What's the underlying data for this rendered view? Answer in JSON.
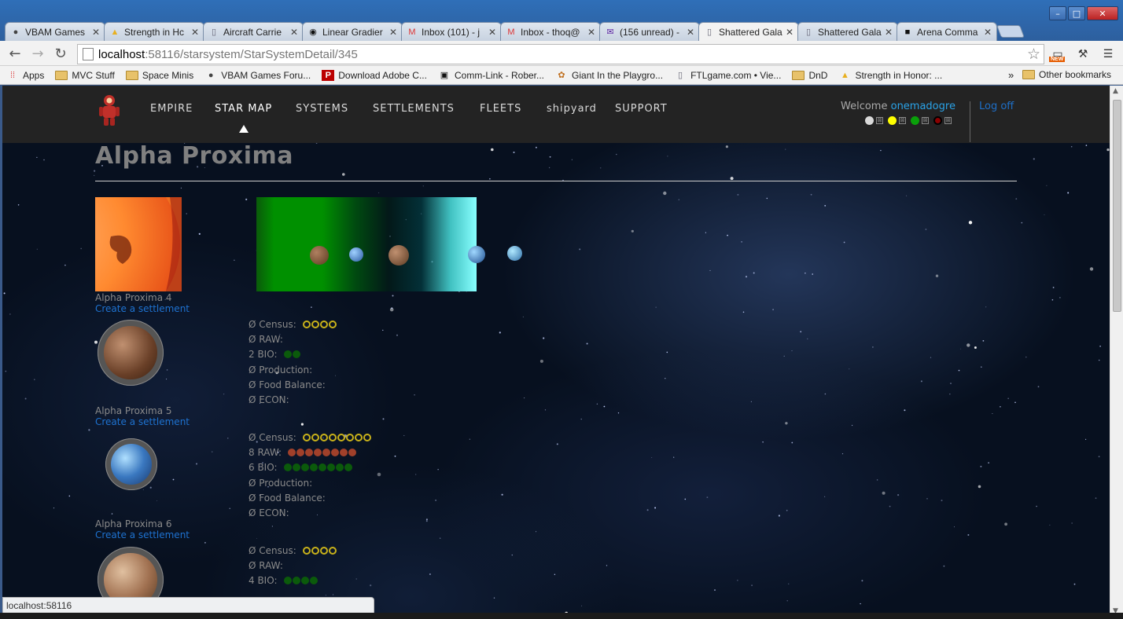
{
  "browser": {
    "tabs": [
      {
        "title": "VBAM Games",
        "icon": "globe-icon"
      },
      {
        "title": "Strength in Hc",
        "icon": "warning-icon"
      },
      {
        "title": "Aircraft Carrie",
        "icon": "page-icon"
      },
      {
        "title": "Linear Gradier",
        "icon": "github-icon"
      },
      {
        "title": "Inbox (101) - j",
        "icon": "gmail-icon"
      },
      {
        "title": "Inbox - thoq@",
        "icon": "gmail-icon"
      },
      {
        "title": "(156 unread) -",
        "icon": "mail-icon"
      },
      {
        "title": "Shattered Gala",
        "icon": "page-icon",
        "active": true
      },
      {
        "title": "Shattered Gala",
        "icon": "page-icon"
      },
      {
        "title": "Arena Comma",
        "icon": "arena-icon"
      }
    ],
    "url_host": "localhost",
    "url_path": ":58116/starsystem/StarSystemDetail/345",
    "new_badge": "NEW",
    "bookmarks": [
      {
        "label": "Apps",
        "icon": "apps-icon"
      },
      {
        "label": "MVC Stuff",
        "icon": "folder-icon"
      },
      {
        "label": "Space Minis",
        "icon": "folder-icon"
      },
      {
        "label": "VBAM Games Foru...",
        "icon": "globe-icon"
      },
      {
        "label": "Download Adobe C...",
        "icon": "pinterest-icon"
      },
      {
        "label": "Comm-Link - Rober...",
        "icon": "rsi-icon"
      },
      {
        "label": "Giant In the Playgro...",
        "icon": "giant-icon"
      },
      {
        "label": "FTLgame.com • Vie...",
        "icon": "page-icon"
      },
      {
        "label": "DnD",
        "icon": "folder-icon"
      },
      {
        "label": "Strength in Honor: ...",
        "icon": "warning-icon"
      }
    ],
    "bookmarks_overflow": "»",
    "other_bookmarks": "Other bookmarks",
    "status_url": "localhost:58116"
  },
  "site": {
    "nav": [
      {
        "label": "EMPIRE"
      },
      {
        "label": "STAR MAP",
        "current": true
      },
      {
        "label": "SYSTEMS"
      },
      {
        "label": "SETTLEMENTS"
      },
      {
        "label": "FLEETS"
      },
      {
        "label": "shipyard"
      },
      {
        "label": "SUPPORT"
      }
    ],
    "welcome_prefix": "Welcome ",
    "username": "onemadogre",
    "logoff": "Log off",
    "player_colors": [
      "#d9d9d9",
      "#ffff00",
      "#0aa00a",
      "#8a0000"
    ],
    "check_glyph": "⊠"
  },
  "system": {
    "title": "Alpha Proxima",
    "planets": [
      {
        "name": "Alpha Proxima 4",
        "link": "Create a settlement",
        "stats": [
          {
            "label": "Ø Census:",
            "pips": 4,
            "pip": "y"
          },
          {
            "label": "Ø RAW:",
            "pips": 0,
            "pip": "r"
          },
          {
            "label": "2 BIO:",
            "pips": 2,
            "pip": "g"
          },
          {
            "label": "Ø Production:",
            "pips": 0
          },
          {
            "label": "Ø Food Balance:",
            "pips": 0
          },
          {
            "label": "Ø ECON:",
            "pips": 0
          }
        ]
      },
      {
        "name": "Alpha Proxima 5",
        "link": "Create a settlement",
        "stats": [
          {
            "label": "Ø Census:",
            "pips": 8,
            "pip": "y"
          },
          {
            "label": "8 RAW:",
            "pips": 8,
            "pip": "r"
          },
          {
            "label": "6 BIO:",
            "pips": 8,
            "pip": "g"
          },
          {
            "label": "Ø Production:",
            "pips": 0
          },
          {
            "label": "Ø Food Balance:",
            "pips": 0
          },
          {
            "label": "Ø ECON:",
            "pips": 0
          }
        ]
      },
      {
        "name": "Alpha Proxima 6",
        "link": "Create a settlement",
        "stats": [
          {
            "label": "Ø Census:",
            "pips": 4,
            "pip": "y"
          },
          {
            "label": "Ø RAW:",
            "pips": 0,
            "pip": "r"
          },
          {
            "label": "4 BIO:",
            "pips": 4,
            "pip": "g"
          }
        ]
      }
    ]
  }
}
